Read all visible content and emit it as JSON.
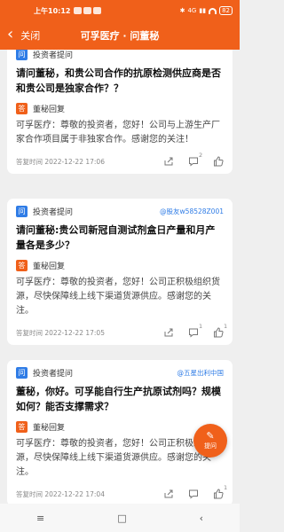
{
  "status_bar": {
    "time": "上午10:12",
    "network": "4G",
    "battery": "82"
  },
  "nav": {
    "back_icon": "chevron-left-icon",
    "close_label": "关闭",
    "title": "可孚医疗 · 问董秘"
  },
  "labels": {
    "investor_ask": "投资者提问",
    "board_reply": "董秘回复",
    "reply_time_prefix": "答复时间"
  },
  "cards": [
    {
      "asker": "",
      "question": "请问董秘，和贵公司合作的抗原检测供应商是否和贵公司是独家合作？？",
      "answer": "可孚医疗：尊敬的投资者，您好！公司与上游生产厂家合作项目属于非独家合作。感谢您的关注！",
      "time": "答复时间 2022-12-22 17:06",
      "comment_count": "2",
      "like_count": ""
    },
    {
      "asker": "@股友w58528Z001",
      "question": "请问董秘:贵公司新冠自测试剂盒日产量和月产量各是多少？",
      "answer": "可孚医疗：尊敬的投资者，您好！公司正积极组织货源，尽快保障线上线下渠道货源供应。感谢您的关注。",
      "time": "答复时间 2022-12-22 17:05",
      "comment_count": "1",
      "like_count": "1"
    },
    {
      "asker": "@五星出利中国",
      "question": "董秘，你好。可孚能自行生产抗原试剂吗？规模如何？能否支撑需求？",
      "answer": "可孚医疗：尊敬的投资者，您好！公司正积极组织货源，尽快保障线上线下渠道货源供应。感谢您的关注。",
      "time": "答复时间 2022-12-22 17:04",
      "comment_count": "",
      "like_count": "1"
    }
  ],
  "fab": {
    "label": "提问",
    "icon": "pen-icon"
  },
  "bottom_nav": {
    "menu": "≡",
    "home": "□",
    "back": "‹"
  },
  "colors": {
    "brand": "#f0601a",
    "ask_blue": "#2f7ce6"
  }
}
